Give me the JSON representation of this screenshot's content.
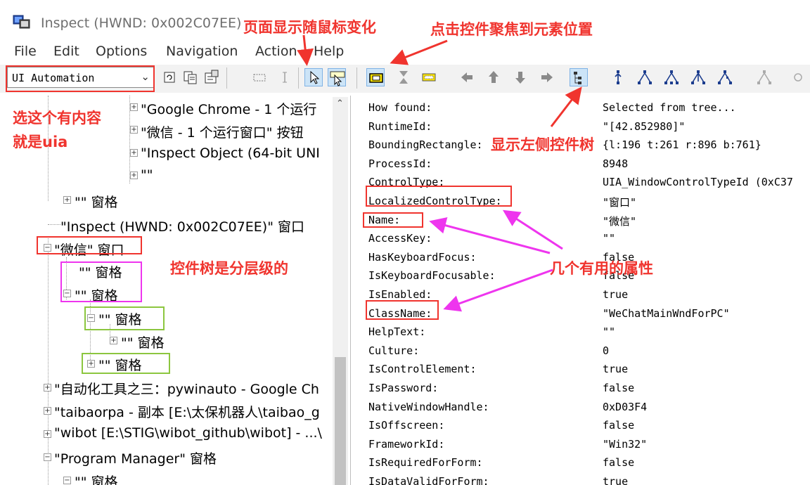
{
  "window": {
    "title": "Inspect  (HWND: 0x002C07EE)"
  },
  "menu": {
    "items": [
      "File",
      "Edit",
      "Options",
      "Navigation",
      "Action",
      "Help"
    ]
  },
  "toolbar": {
    "mode_select_value": "UI Automation",
    "icons": [
      "refresh-icon",
      "copy-icon",
      "properties-icon",
      "rectangle-icon",
      "caret-icon",
      "pointer-icon",
      "pointer-tooltip-icon",
      "highlight-rectangle-icon",
      "caret-tracking-icon",
      "focus-tracking-icon",
      "nav-prev-icon",
      "nav-up-icon",
      "nav-down-icon",
      "nav-next-icon",
      "show-tree-icon",
      "nav-parent-icon",
      "nav-first-child-icon",
      "nav-previous-sibling-icon",
      "nav-next-sibling-icon",
      "nav-last-child-icon",
      "tree-walker-icon"
    ]
  },
  "tree": {
    "items": [
      {
        "label": "\"Google Chrome - 1 个运行"
      },
      {
        "label": "\"微信 - 1 个运行窗口\" 按钮"
      },
      {
        "label": "\"Inspect Object (64-bit UNI"
      },
      {
        "label": "\"\""
      },
      {
        "label": "\"\" 窗格"
      },
      {
        "label": "\"Inspect  (HWND: 0x002C07EE)\" 窗口"
      },
      {
        "label": "\"微信\" 窗口"
      },
      {
        "label": "\"\" 窗格"
      },
      {
        "label": "\"\" 窗格"
      },
      {
        "label": "\"\" 窗格"
      },
      {
        "label": "\"\" 窗格"
      },
      {
        "label": "\"\" 窗格"
      },
      {
        "label": "\"自动化工具之三：pywinauto - Google Ch"
      },
      {
        "label": "\"taibaorpa - 副本 [E:\\太保机器人\\taibao_g"
      },
      {
        "label": "\"wibot [E:\\STIG\\wibot_github\\wibot] - ...\\"
      },
      {
        "label": "\"Program Manager\" 窗格"
      },
      {
        "label": "\"\" 窗格"
      }
    ]
  },
  "properties": [
    {
      "name": "How found:",
      "value": "Selected from tree..."
    },
    {
      "name": "RuntimeId:",
      "value": "\"[42.852980]\""
    },
    {
      "name": "BoundingRectangle:",
      "value": "{l:196 t:261 r:896 b:761}"
    },
    {
      "name": "ProcessId:",
      "value": "8948"
    },
    {
      "name": "ControlType:",
      "value": "UIA_WindowControlTypeId (0xC37"
    },
    {
      "name": "LocalizedControlType:",
      "value": "\"窗口\""
    },
    {
      "name": "Name:",
      "value": "\"微信\""
    },
    {
      "name": "AccessKey:",
      "value": "\"\""
    },
    {
      "name": "HasKeyboardFocus:",
      "value": "false"
    },
    {
      "name": "IsKeyboardFocusable:",
      "value": "false"
    },
    {
      "name": "IsEnabled:",
      "value": "true"
    },
    {
      "name": "ClassName:",
      "value": "\"WeChatMainWndForPC\""
    },
    {
      "name": "HelpText:",
      "value": "\"\""
    },
    {
      "name": "Culture:",
      "value": "0"
    },
    {
      "name": "IsControlElement:",
      "value": "true"
    },
    {
      "name": "IsPassword:",
      "value": "false"
    },
    {
      "name": "NativeWindowHandle:",
      "value": "0xD03F4"
    },
    {
      "name": "IsOffscreen:",
      "value": "false"
    },
    {
      "name": "FrameworkId:",
      "value": "\"Win32\""
    },
    {
      "name": "IsRequiredForForm:",
      "value": "false"
    },
    {
      "name": "IsDataValidForForm:",
      "value": "true"
    }
  ],
  "annotations": {
    "page_mouse": "页面显示随鼠标变化",
    "click_focus": "点击控件聚焦到元素位置",
    "choose_content": "选这个有内容",
    "is_uia": "就是uia",
    "show_tree": "显示左侧控件树",
    "hierarchy": "控件树是分层级的",
    "useful_props": "几个有用的属性"
  },
  "colors": {
    "annotation_red": "#f0342e",
    "annotation_magenta": "#ee35ee",
    "annotation_green": "#8cc63f",
    "toolbar_bg": "#f2f2f2",
    "active_button_bg": "#cce4f7"
  }
}
